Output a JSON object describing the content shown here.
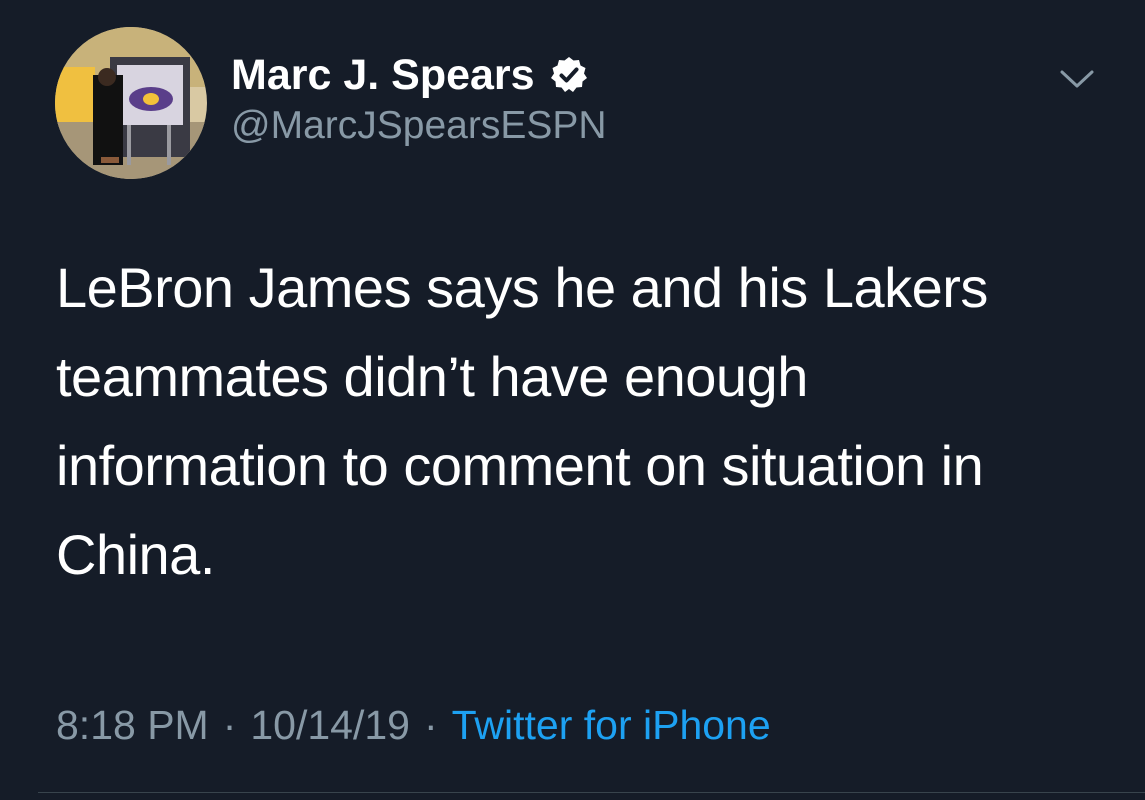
{
  "tweet": {
    "author": {
      "display_name": "Marc J. Spears",
      "handle": "@MarcJSpearsESPN",
      "verified": true,
      "avatar_icon": "profile-photo"
    },
    "text": "LeBron James says he and his Lakers\nteammates didn’t have enough\ninformation to comment on situation in\nChina.",
    "time": "8:18 PM",
    "separator": "·",
    "date": "10/14/19",
    "source": "Twitter for iPhone",
    "menu_icon": "chevron-down-icon"
  },
  "colors": {
    "background": "#151c28",
    "primary_text": "#ffffff",
    "secondary_text": "#8899a6",
    "link": "#1da1f2",
    "divider": "#38444d"
  }
}
